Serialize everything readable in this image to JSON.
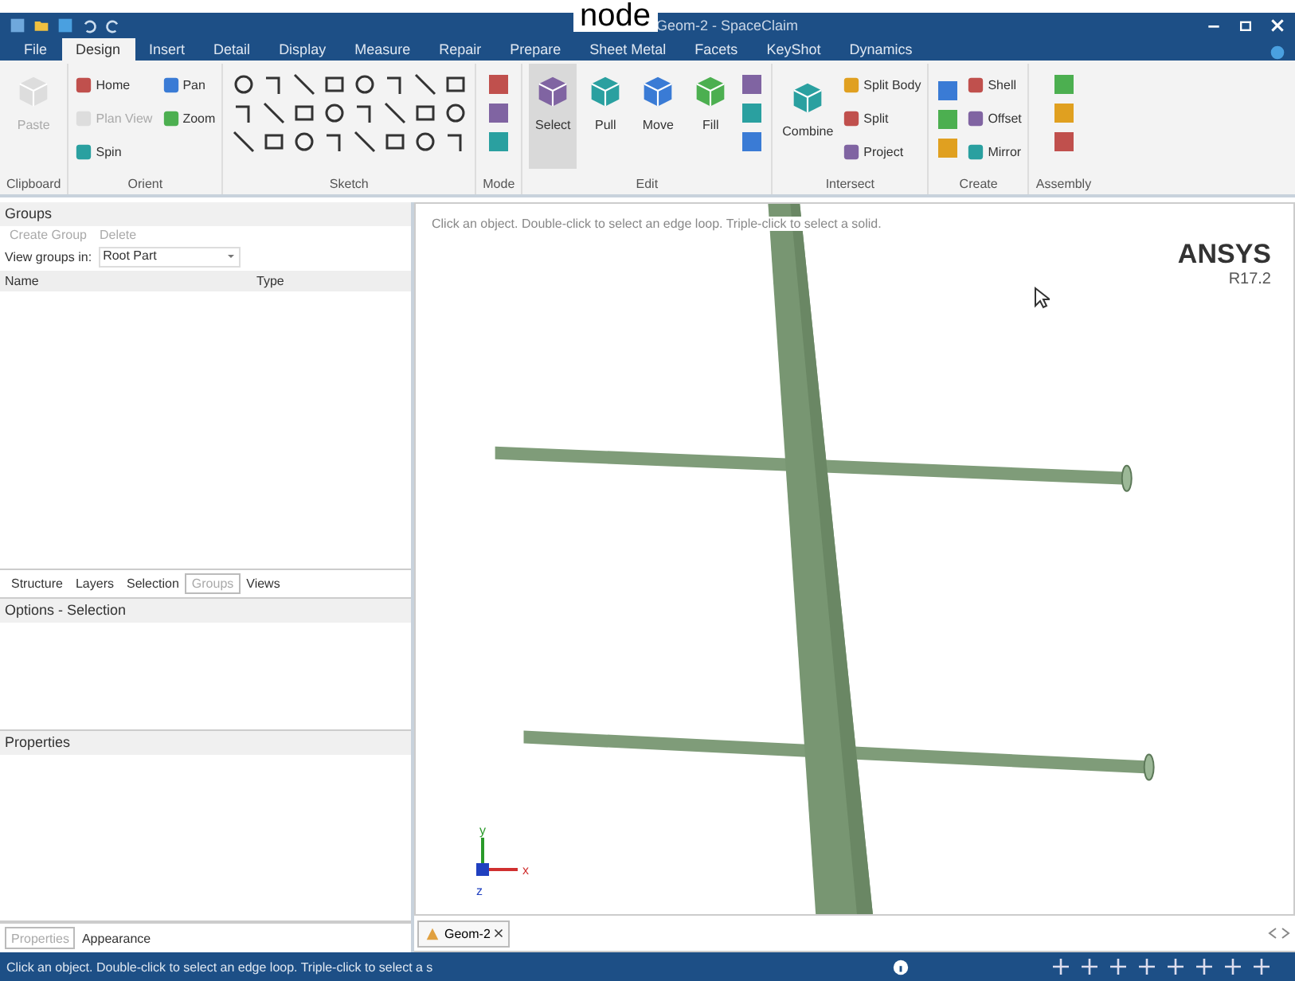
{
  "caption": "node",
  "window": {
    "title": "Geom-2 - SpaceClaim"
  },
  "ribbon_tabs": [
    {
      "label": "File",
      "selected": false
    },
    {
      "label": "Design",
      "selected": true
    },
    {
      "label": "Insert",
      "selected": false
    },
    {
      "label": "Detail",
      "selected": false
    },
    {
      "label": "Display",
      "selected": false
    },
    {
      "label": "Measure",
      "selected": false
    },
    {
      "label": "Repair",
      "selected": false
    },
    {
      "label": "Prepare",
      "selected": false
    },
    {
      "label": "Sheet Metal",
      "selected": false
    },
    {
      "label": "Facets",
      "selected": false
    },
    {
      "label": "KeyShot",
      "selected": false
    },
    {
      "label": "Dynamics",
      "selected": false
    }
  ],
  "ribbon_groups": [
    {
      "label": "Clipboard",
      "items": [
        {
          "kind": "large",
          "label": "Paste",
          "disabled": true,
          "selected": false
        }
      ]
    },
    {
      "label": "Orient",
      "items": [
        {
          "kind": "small",
          "label": "Home",
          "disabled": false
        },
        {
          "kind": "small",
          "label": "Plan View",
          "disabled": true
        },
        {
          "kind": "small",
          "label": "Spin",
          "disabled": false
        },
        {
          "kind": "small",
          "label": "Pan",
          "disabled": false
        },
        {
          "kind": "small",
          "label": "Zoom",
          "disabled": false
        }
      ]
    },
    {
      "label": "Sketch",
      "items": [
        {
          "kind": "tools"
        }
      ]
    },
    {
      "label": "Mode",
      "items": [
        {
          "kind": "modes"
        }
      ]
    },
    {
      "label": "Edit",
      "items": [
        {
          "kind": "large",
          "label": "Select",
          "disabled": false,
          "selected": true
        },
        {
          "kind": "large",
          "label": "Pull",
          "disabled": false,
          "selected": false
        },
        {
          "kind": "large",
          "label": "Move",
          "disabled": false,
          "selected": false
        },
        {
          "kind": "large",
          "label": "Fill",
          "disabled": false,
          "selected": false
        },
        {
          "kind": "modes"
        }
      ]
    },
    {
      "label": "Intersect",
      "items": [
        {
          "kind": "large",
          "label": "Combine",
          "disabled": false,
          "selected": false
        },
        {
          "kind": "small",
          "label": "Split Body",
          "disabled": false
        },
        {
          "kind": "small",
          "label": "Split",
          "disabled": false
        },
        {
          "kind": "small",
          "label": "Project",
          "disabled": false
        }
      ]
    },
    {
      "label": "Create",
      "items": [
        {
          "kind": "modes"
        },
        {
          "kind": "small",
          "label": "Shell",
          "disabled": false
        },
        {
          "kind": "small",
          "label": "Offset",
          "disabled": false
        },
        {
          "kind": "small",
          "label": "Mirror",
          "disabled": false
        }
      ]
    },
    {
      "label": "Assembly",
      "items": [
        {
          "kind": "modes"
        }
      ]
    }
  ],
  "groups_panel": {
    "title": "Groups",
    "actions": [
      {
        "label": "Create Group",
        "disabled": true
      },
      {
        "label": "Delete",
        "disabled": true
      }
    ],
    "view_label": "View groups in:",
    "view_value": "Root Part",
    "columns": [
      "Name",
      "Type"
    ]
  },
  "panel_tabs": [
    {
      "label": "Structure",
      "selected": false
    },
    {
      "label": "Layers",
      "selected": false
    },
    {
      "label": "Selection",
      "selected": false
    },
    {
      "label": "Groups",
      "selected": true
    },
    {
      "label": "Views",
      "selected": false
    }
  ],
  "options_panel": {
    "title": "Options - Selection"
  },
  "properties_panel": {
    "title": "Properties"
  },
  "bottom_tabs": [
    {
      "label": "Properties",
      "selected": true
    },
    {
      "label": "Appearance",
      "selected": false
    }
  ],
  "viewport": {
    "hint": "Click an object. Double-click to select an edge loop. Triple-click to select a solid.",
    "logo": "ANSYS",
    "version": "R17.2",
    "axes": [
      "y",
      "x",
      "z"
    ]
  },
  "document_tabs": [
    {
      "label": "Geom-2"
    }
  ],
  "status_bar": {
    "message": "Click an object. Double-click to select an edge loop. Triple-click to select a s"
  }
}
